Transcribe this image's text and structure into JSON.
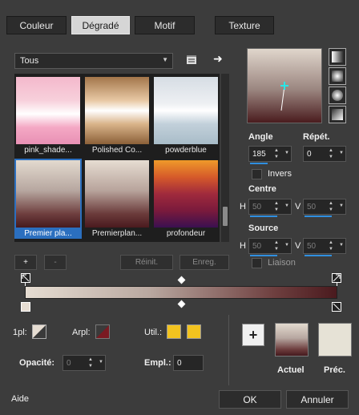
{
  "tabs": [
    {
      "label": "Couleur"
    },
    {
      "label": "Dégradé",
      "active": true
    },
    {
      "label": "Motif"
    },
    {
      "label": "Texture"
    }
  ],
  "category": {
    "selected": "Tous"
  },
  "gallery": {
    "items": [
      {
        "label": "pink_shade..."
      },
      {
        "label": "Polished Co..."
      },
      {
        "label": "powderblue"
      },
      {
        "label": "Premier pla...",
        "selected": true
      },
      {
        "label": "Premierplan..."
      },
      {
        "label": "profondeur"
      }
    ]
  },
  "gallery_buttons": {
    "add": "+",
    "remove": "-",
    "reset": "Réinit.",
    "save": "Enreg."
  },
  "angle": {
    "label": "Angle",
    "value": "185"
  },
  "repeat": {
    "label": "Répét.",
    "value": "0"
  },
  "invert": {
    "label": "Invers"
  },
  "centre": {
    "label": "Centre",
    "h_label": "H",
    "h_value": "50",
    "v_label": "V",
    "v_value": "50"
  },
  "source": {
    "label": "Source",
    "h_label": "H",
    "h_value": "50",
    "v_label": "V",
    "v_value": "50"
  },
  "link": {
    "label": "Liaison"
  },
  "stop_controls": {
    "first_label": "1pl:",
    "bg_label": "Arpl:",
    "user_label": "Util.:",
    "opacity_label": "Opacité:",
    "opacity_value": "0",
    "location_label": "Empl.:",
    "location_value": "0"
  },
  "current": {
    "label": "Actuel"
  },
  "previous": {
    "label": "Préc."
  },
  "add_swatch_label": "+",
  "footer": {
    "help": "Aide",
    "ok": "OK",
    "cancel": "Annuler"
  },
  "colors": {
    "accent": "#2f8fe0",
    "user_swatch": "#f2c31f",
    "gradient_start": "#e6ddd2",
    "gradient_end": "#4a1a1e"
  }
}
